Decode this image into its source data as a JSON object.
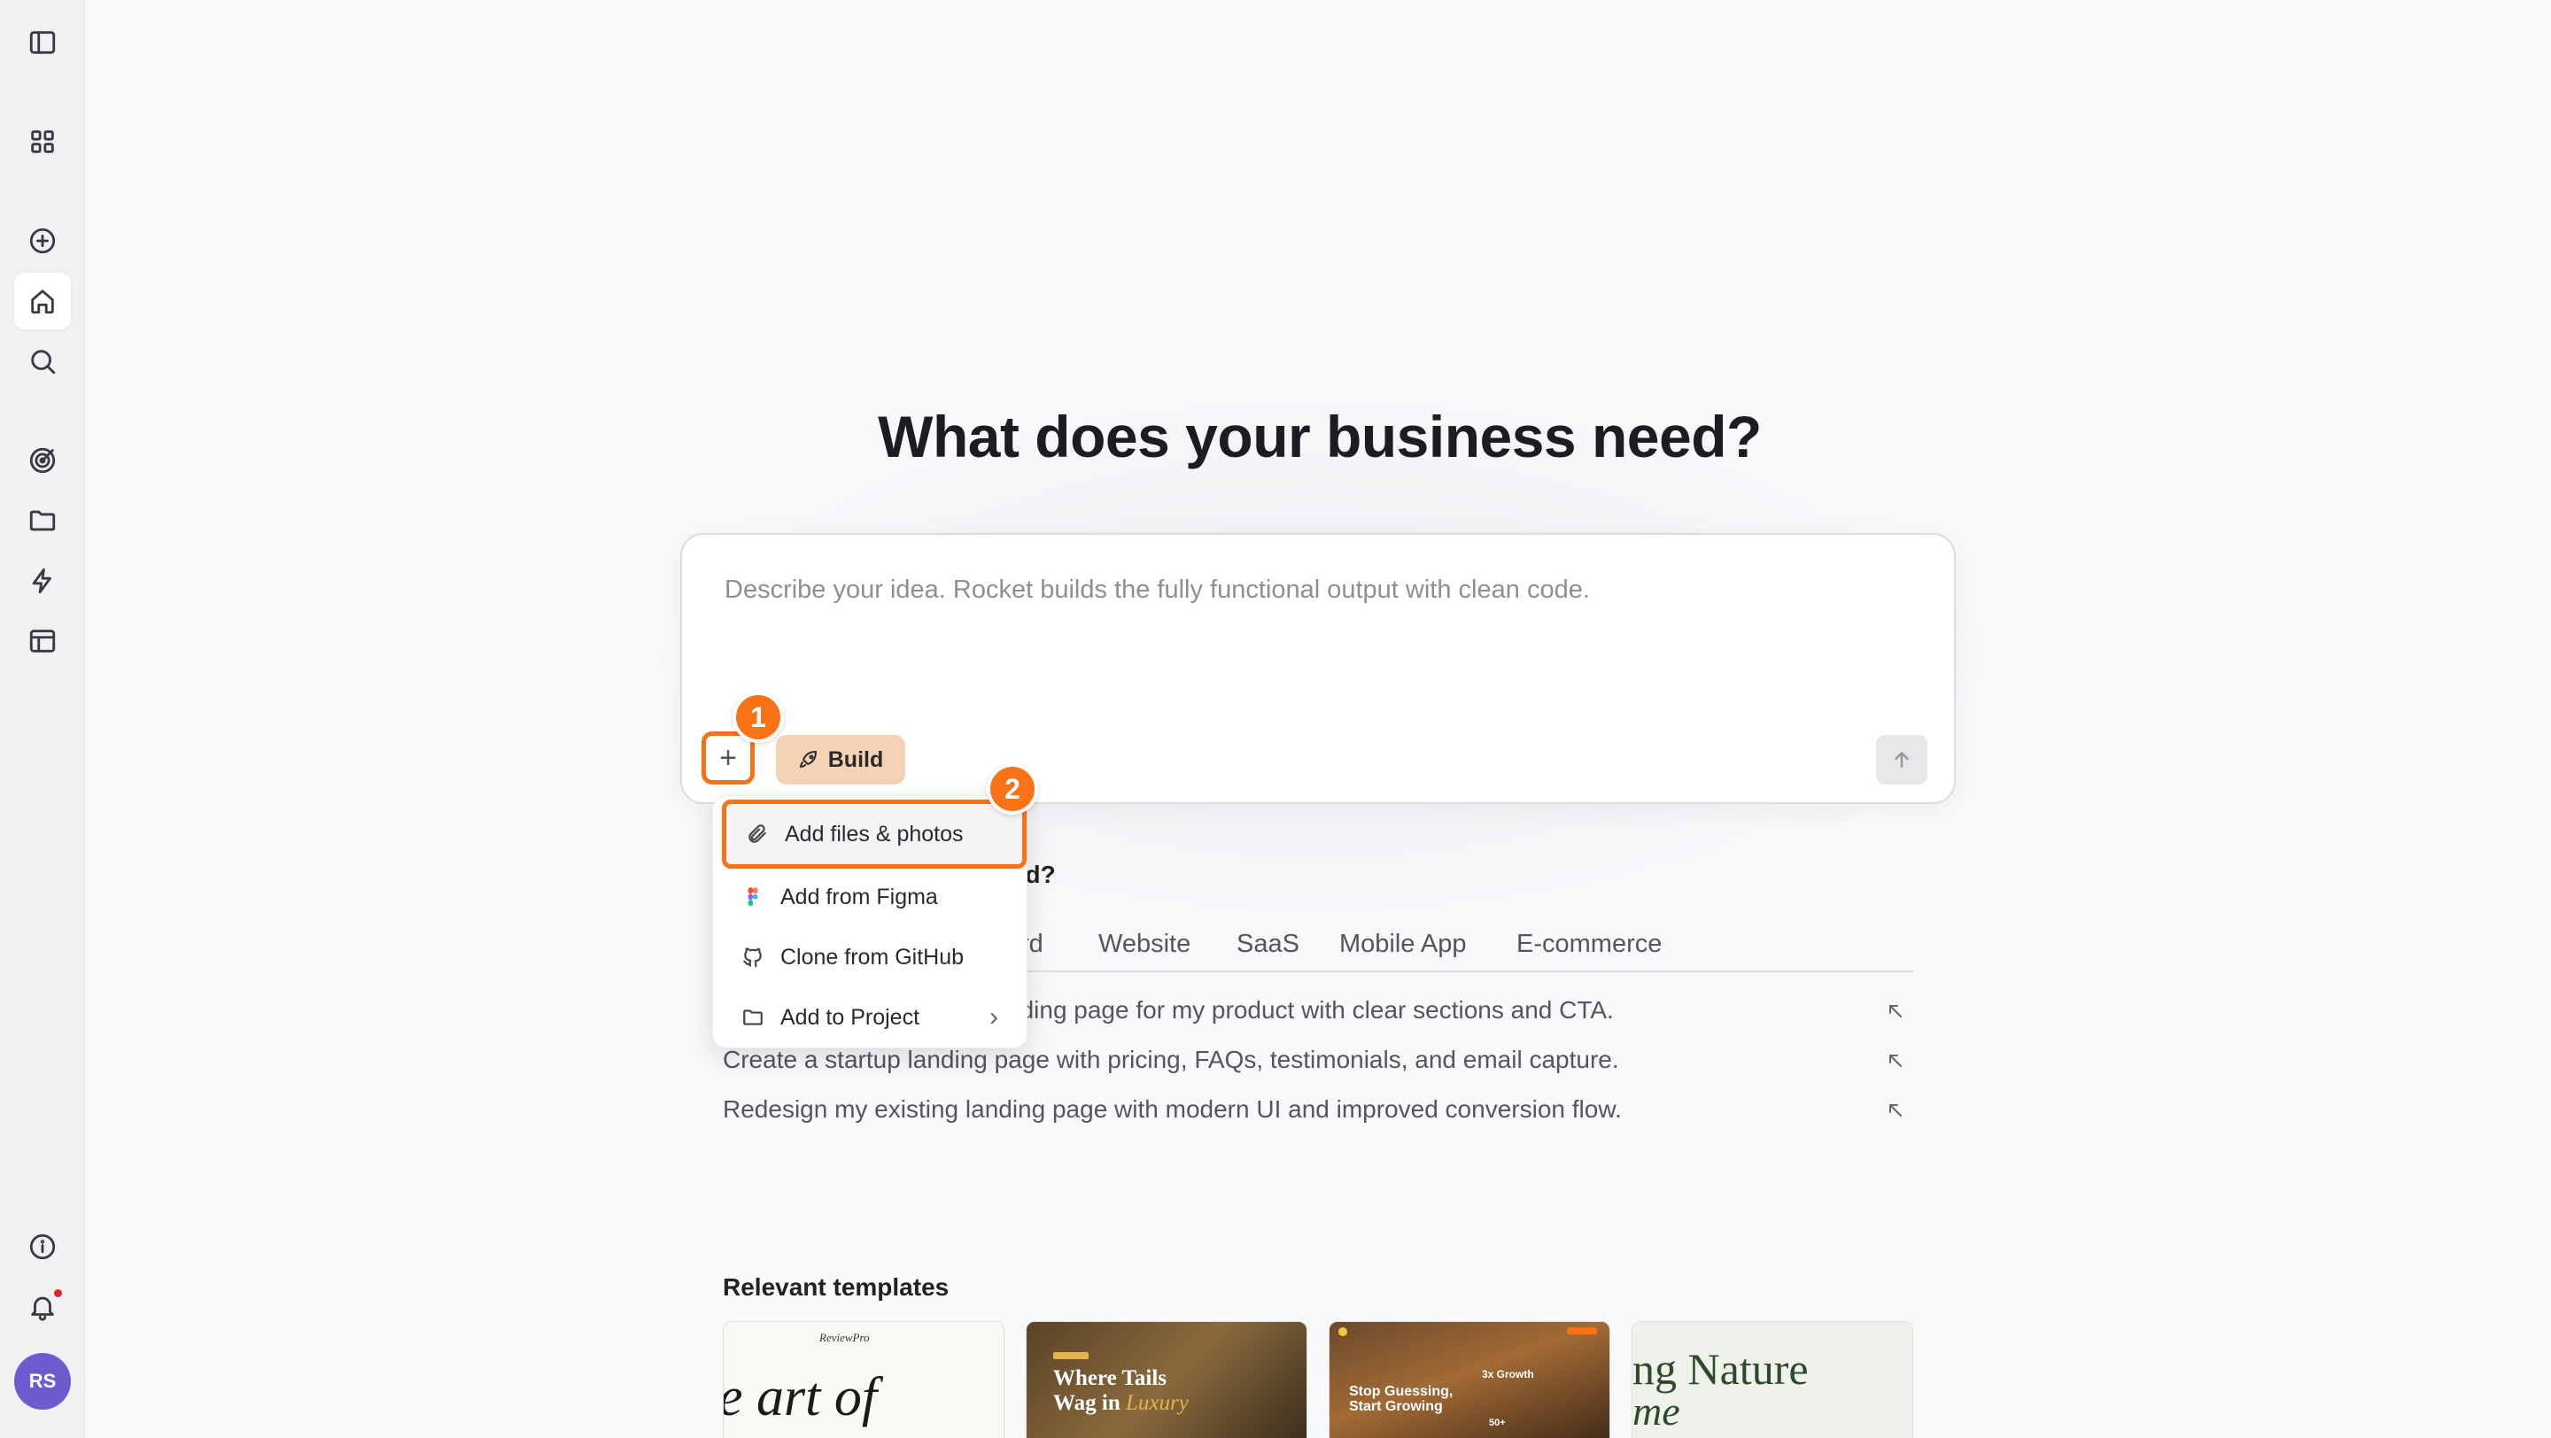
{
  "sidebar": {
    "avatar_initials": "RS",
    "notification_dot_color": "#e02424"
  },
  "main": {
    "headline": "What does your business need?",
    "prompt": {
      "placeholder": "Describe your idea. Rocket builds the fully functional output with clean code.",
      "build_label": "Build"
    },
    "steps": {
      "one": "1",
      "two": "2"
    },
    "menu": {
      "items": [
        {
          "label": "Add files & photos",
          "icon": "paperclip-icon"
        },
        {
          "label": "Add from Figma",
          "icon": "figma-icon"
        },
        {
          "label": "Clone from GitHub",
          "icon": "github-icon"
        },
        {
          "label": "Add to Project",
          "icon": "folder-icon",
          "has_submenu": true
        }
      ]
    },
    "section_question_visible": "ild?",
    "tabs": [
      "rd",
      "Website",
      "SaaS",
      "Mobile App",
      "E-commerce"
    ],
    "suggestions": [
      "nding page for my product with clear sections and CTA.",
      "Create a startup landing page with pricing, FAQs, testimonials, and email capture.",
      "Redesign my existing landing page with modern UI and improved conversion flow."
    ],
    "templates": {
      "title": "Relevant templates",
      "cards": [
        {
          "brand": "ReviewPro",
          "headline": "e art of"
        },
        {
          "headline_a": "Where Tails",
          "headline_b": "Wag in ",
          "headline_accent": "Luxury"
        },
        {
          "headline": "Stop Guessing, Start Growing",
          "stat1": "3x Growth",
          "stat2": "50+"
        },
        {
          "headline": "ng Nature",
          "sub": "me"
        }
      ]
    }
  },
  "colors": {
    "accent_orange": "#f97316",
    "build_button": "#f3d3b4",
    "avatar": "#6d5bd0"
  }
}
